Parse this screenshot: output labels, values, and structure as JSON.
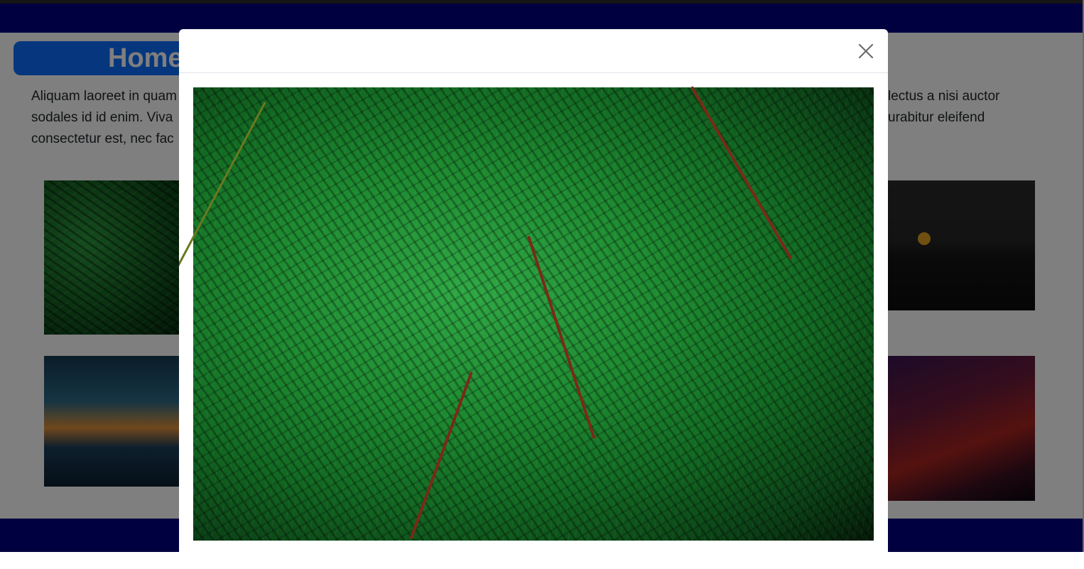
{
  "page": {
    "title": "Home",
    "intro_lines": [
      "Aliquam laoreet in quam",
      "sodales id id enim. Viva",
      "consectetur est, nec fac"
    ],
    "intro_right_lines": [
      "lectus a nisi auctor",
      "urabitur eleifend"
    ]
  },
  "gallery": {
    "items": [
      {
        "name": "fern-thumbnail"
      },
      {
        "name": "night-landscape-thumbnail"
      },
      {
        "name": "forest-sunset-thumbnail"
      },
      {
        "name": "polygon-mountain-thumbnail"
      }
    ]
  },
  "modal": {
    "close_icon": "close-icon",
    "image": "fern-leaves-with-water-drops"
  },
  "colors": {
    "navbar": "#000080",
    "title_bg": "#0d6efd",
    "backdrop": "rgba(0,0,0,0.5)",
    "modal_bg": "#ffffff"
  }
}
